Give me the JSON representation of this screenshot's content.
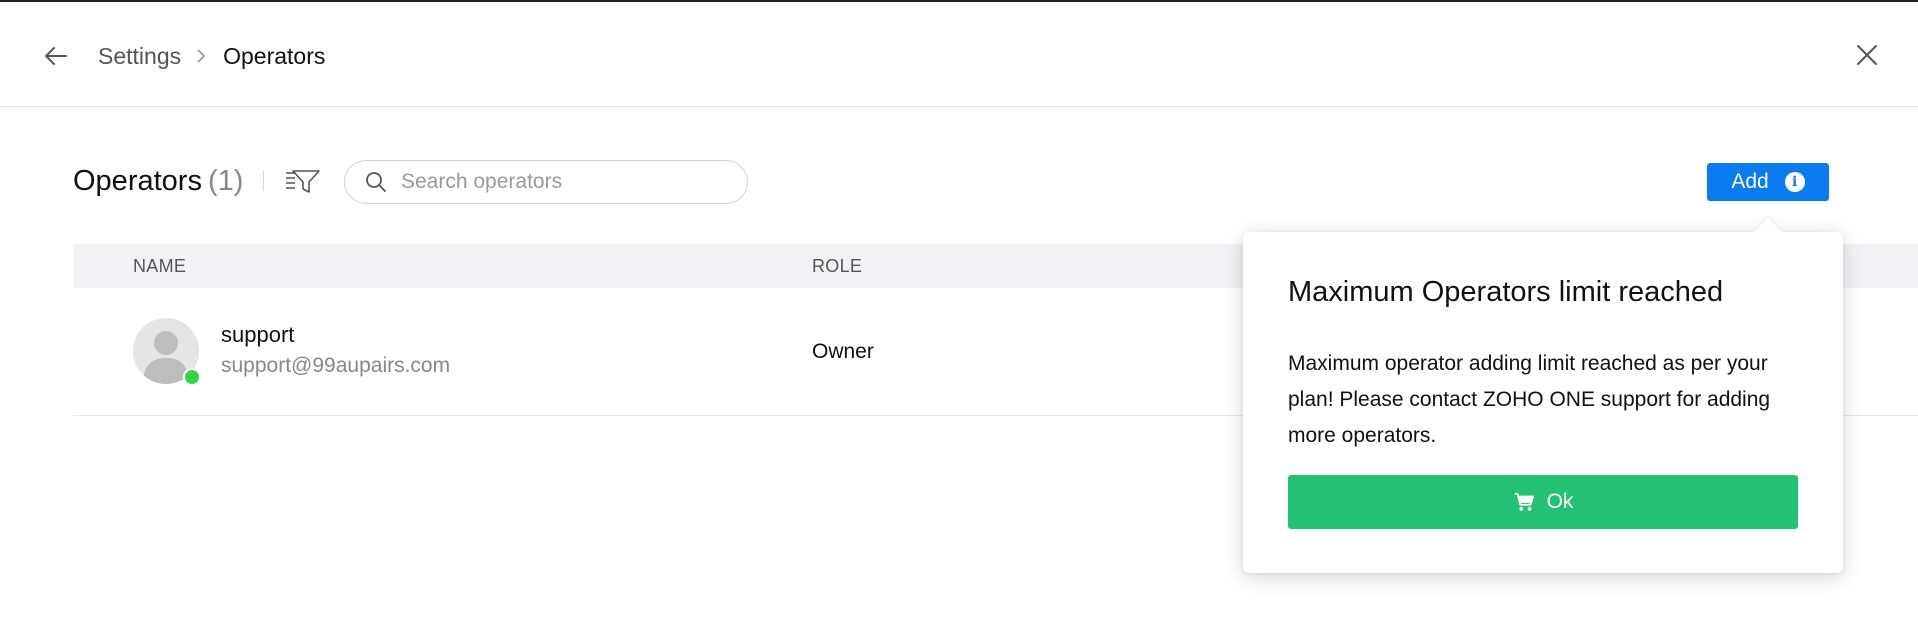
{
  "header": {
    "breadcrumb": [
      "Settings",
      "Operators"
    ]
  },
  "toolbar": {
    "title": "Operators",
    "count": "(1)",
    "search_placeholder": "Search operators",
    "add_label": "Add"
  },
  "table": {
    "columns": [
      "NAME",
      "ROLE"
    ],
    "rows": [
      {
        "name": "support",
        "email": "support@99aupairs.com",
        "role": "Owner",
        "status": "online"
      }
    ]
  },
  "popover": {
    "title": "Maximum Operators limit reached",
    "body": "Maximum operator adding limit reached as per your plan! Please contact ZOHO ONE support for adding more operators.",
    "ok_label": "Ok"
  },
  "colors": {
    "primary": "#0a7cf0",
    "success": "#24c174",
    "online": "#3bd04a"
  },
  "icons": [
    "back-arrow-icon",
    "chevron-right-icon",
    "close-icon",
    "filter-icon",
    "search-icon",
    "info-icon",
    "cart-icon"
  ]
}
